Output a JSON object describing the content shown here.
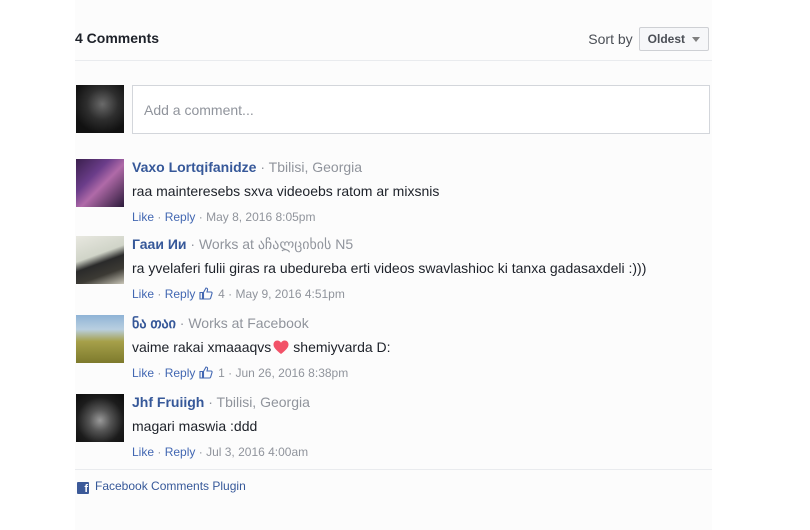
{
  "header": {
    "count_label": "4 Comments",
    "sort_label": "Sort by",
    "sort_value": "Oldest"
  },
  "compose": {
    "placeholder": "Add a comment..."
  },
  "comments": [
    {
      "author": "Vaxo Lortqifanidze",
      "meta": "Tbilisi, Georgia",
      "text": "raa mainteresebs sxva videoebs ratom ar mixsnis",
      "like": "Like",
      "reply": "Reply",
      "likes": "",
      "time": "May 8, 2016 8:05pm"
    },
    {
      "author": "Гааи Ии",
      "meta": "Works at აჩალციხის N5",
      "text": "ra yvelaferi fulii giras ra ubedureba erti videos swavlashioc ki tanxa gadasaxdeli :)))",
      "like": "Like",
      "reply": "Reply",
      "likes": "4",
      "time": "May 9, 2016 4:51pm"
    },
    {
      "author": "ნა თაი",
      "meta": "Works at Facebook",
      "text_before": "vaime rakai xmaaaqvs",
      "text_after": "shemiyvarda D:",
      "like": "Like",
      "reply": "Reply",
      "likes": "1",
      "time": "Jun 26, 2016 8:38pm"
    },
    {
      "author": "Jhf Fruiigh",
      "meta": "Tbilisi, Georgia",
      "text": "magari maswia :ddd",
      "like": "Like",
      "reply": "Reply",
      "likes": "",
      "time": "Jul 3, 2016 4:00am"
    }
  ],
  "footer": {
    "plugin_label": "Facebook Comments Plugin"
  },
  "colors": {
    "link": "#365899",
    "action": "#4267b2",
    "muted": "#90949c",
    "heart": "#f25268"
  }
}
